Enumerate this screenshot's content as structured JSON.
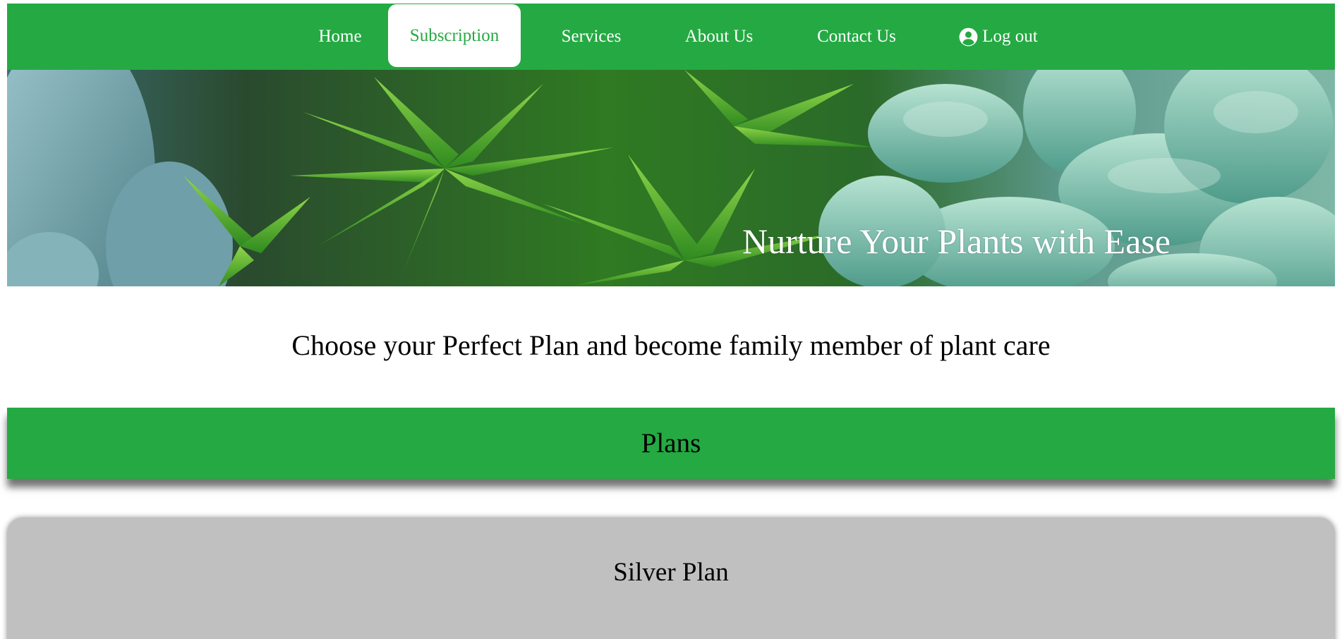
{
  "nav": {
    "items": [
      {
        "label": "Home"
      },
      {
        "label": "Subscription",
        "active": true
      },
      {
        "label": "Services"
      },
      {
        "label": "About Us"
      },
      {
        "label": "Contact Us"
      },
      {
        "label": "Log out",
        "icon": "user-circle-icon"
      }
    ]
  },
  "hero": {
    "title": "Nurture Your Plants with Ease"
  },
  "main": {
    "tagline": "Choose your Perfect Plan and become family member of plant care",
    "plans_heading": "Plans",
    "cards": [
      {
        "title": "Silver Plan"
      }
    ]
  },
  "colors": {
    "brand_green": "#25a943",
    "card_gray": "#c0c0c0",
    "white": "#ffffff"
  }
}
